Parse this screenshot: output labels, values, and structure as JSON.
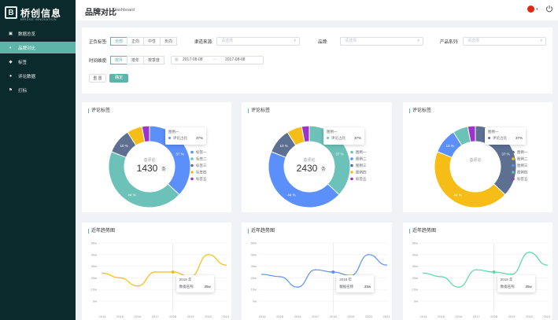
{
  "sidebar": {
    "logo_text": "桥创信息",
    "logo_sub": "BRIDGE INNOVATION",
    "items": [
      {
        "label": "数据总览",
        "icon": "dashboard-icon"
      },
      {
        "label": "品牌对比",
        "icon": "compare-icon"
      },
      {
        "label": "标签",
        "icon": "tag-icon"
      },
      {
        "label": "评论数据",
        "icon": "comment-icon"
      },
      {
        "label": "打标",
        "icon": "flag-icon"
      }
    ],
    "active_index": 1
  },
  "header": {
    "title": "品牌对比",
    "subtitle": "Dashboard",
    "language_flag": "cn-flag-icon"
  },
  "filter": {
    "sentiment": {
      "label": "正负标签:",
      "options": [
        "全部",
        "正向",
        "中性",
        "负向"
      ],
      "selected": "全部"
    },
    "channel": {
      "label": "渠道来源:",
      "placeholder": "请选择"
    },
    "brand": {
      "label": "品牌:",
      "placeholder": "请选择"
    },
    "series": {
      "label": "产品系列:",
      "placeholder": "请选择"
    },
    "time": {
      "label": "时间维度:",
      "options": [
        "按月",
        "按年",
        "按季度"
      ],
      "selected": "按月"
    },
    "date_start": "2017-08-08",
    "date_sep": "—",
    "date_end": "2017-08-08",
    "reset_label": "重 置",
    "confirm_label": "确定"
  },
  "donut_cards": [
    {
      "title": "评论标签",
      "center_label": "总评论",
      "center_value": "1430",
      "center_unit": "条",
      "tooltip": {
        "title": "图例一",
        "row_label": "评论占比",
        "row_value": "37%"
      }
    },
    {
      "title": "评论标签",
      "center_label": "总评论",
      "center_value": "2430",
      "center_unit": "条",
      "tooltip": {
        "title": "图例一",
        "row_label": "评论占比",
        "row_value": "37%"
      }
    },
    {
      "title": "评论标签",
      "center_label": "总评论",
      "center_value": "",
      "center_unit": "",
      "tooltip": {
        "title": "图例一",
        "row_label": "评论占比",
        "row_value": "37%"
      }
    }
  ],
  "line_cards": [
    {
      "title": "近年趋势图",
      "tooltip": {
        "title": "2018 年",
        "row_label": "数据名称",
        "row_value": "25w"
      }
    },
    {
      "title": "近年趋势图",
      "tooltip": {
        "title": "2018 年",
        "row_label": "数据名称",
        "row_value": "25w"
      }
    },
    {
      "title": "近年趋势图",
      "tooltip": {
        "title": "2018 年",
        "row_label": "数据名称",
        "row_value": "25w"
      }
    }
  ],
  "chart_data": [
    {
      "type": "pie",
      "donut": true,
      "legend_position": "right",
      "series": [
        {
          "name": "标签一",
          "value": 37,
          "label": "37 %"
        },
        {
          "name": "标签二",
          "value": 44,
          "label": "44 %"
        },
        {
          "name": "标签三",
          "value": 10,
          "label": "10 %"
        },
        {
          "name": "标签四",
          "value": 6
        },
        {
          "name": "标签五",
          "value": 3
        }
      ],
      "colors": [
        "#5b8ff9",
        "#6cc1b8",
        "#5d7092",
        "#f6bd16",
        "#9e32cd"
      ]
    },
    {
      "type": "pie",
      "donut": true,
      "legend_position": "right",
      "series": [
        {
          "name": "图例一",
          "value": 37,
          "label": "37 %"
        },
        {
          "name": "图例二",
          "value": 44,
          "label": "44 %"
        },
        {
          "name": "图例三",
          "value": 10,
          "label": "10 %"
        },
        {
          "name": "图例四",
          "value": 6
        },
        {
          "name": "标签五",
          "value": 3
        }
      ],
      "colors": [
        "#6cc1b8",
        "#5b8ff9",
        "#5d7092",
        "#f6bd16",
        "#9e32cd"
      ]
    },
    {
      "type": "pie",
      "donut": true,
      "legend_position": "right",
      "series": [
        {
          "name": "图例一",
          "value": 37,
          "label": "37 %"
        },
        {
          "name": "图例二",
          "value": 44,
          "label": "44 %"
        },
        {
          "name": "图例三",
          "value": 10,
          "label": "10 %"
        },
        {
          "name": "图例四",
          "value": 6
        },
        {
          "name": "标签五",
          "value": 3
        }
      ],
      "colors": [
        "#5d7092",
        "#f6bd16",
        "#5b8ff9",
        "#6cc1b8",
        "#9e32cd"
      ]
    },
    {
      "type": "line",
      "smooth": true,
      "x": [
        "2014",
        "2015",
        "2016",
        "2017",
        "2018",
        "2019",
        "2020",
        "2021"
      ],
      "series": [
        {
          "values": [
            24,
            20,
            13,
            25,
            25,
            21,
            40,
            31
          ]
        }
      ],
      "y_ticks": [
        "0w",
        "10w",
        "20w",
        "30w",
        "40w",
        "50w"
      ],
      "ylim": [
        0,
        50
      ],
      "color": "#f6bd16"
    },
    {
      "type": "line",
      "smooth": true,
      "x": [
        "2014",
        "2015",
        "2016",
        "2017",
        "2018",
        "2019",
        "2020",
        "2021"
      ],
      "series": [
        {
          "values": [
            23,
            21,
            12,
            27,
            25,
            22,
            40,
            31
          ]
        }
      ],
      "y_ticks": [
        "0w",
        "10w",
        "20w",
        "30w",
        "40w",
        "50w"
      ],
      "ylim": [
        0,
        50
      ],
      "color": "#5b8ff9"
    },
    {
      "type": "line",
      "smooth": true,
      "x": [
        "2014",
        "2015",
        "2016",
        "2017",
        "2018",
        "2019",
        "2020",
        "2021"
      ],
      "series": [
        {
          "values": [
            24,
            21,
            12,
            27,
            25,
            23,
            42,
            31
          ]
        }
      ],
      "y_ticks": [
        "0w",
        "10w",
        "20w",
        "30w",
        "40w",
        "50w"
      ],
      "ylim": [
        0,
        50
      ],
      "color": "#5ad8a6"
    }
  ]
}
